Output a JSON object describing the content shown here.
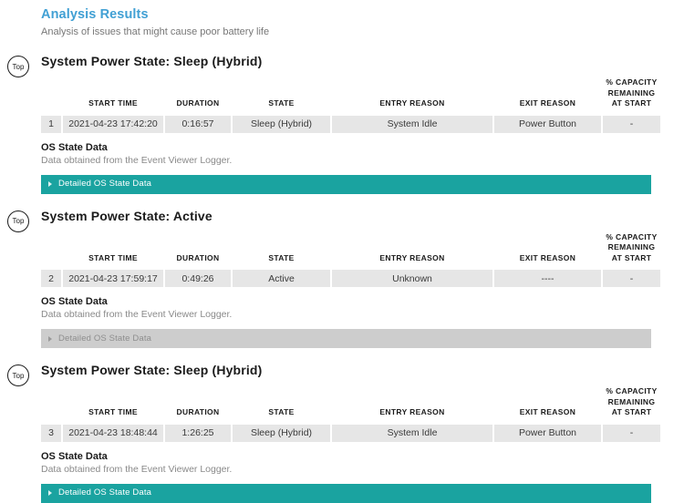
{
  "report": {
    "title": "Analysis Results",
    "subtitle": "Analysis of issues that might cause poor battery life",
    "title_color": "#41a0d4",
    "accent_teal": "#1aa3a0",
    "accent_gray": "#cdcdcd"
  },
  "top_badge_label": "Top",
  "columns": [
    "",
    "START TIME",
    "DURATION",
    "STATE",
    "ENTRY REASON",
    "EXIT REASON",
    "% CAPACITY REMAINING AT START"
  ],
  "columns_capacity_lines": [
    "% CAPACITY",
    "REMAINING",
    "AT START"
  ],
  "os_state": {
    "title": "OS State Data",
    "subtitle": "Data obtained from the Event Viewer Logger.",
    "detail_label": "Detailed OS State Data"
  },
  "sections": [
    {
      "heading": "System Power State: Sleep (Hybrid)",
      "row": {
        "index": "1",
        "start_time": "2021-04-23  17:42:20",
        "duration": "0:16:57",
        "state": "Sleep (Hybrid)",
        "entry_reason": "System Idle",
        "exit_reason": "Power Button",
        "capacity_remaining": "-"
      },
      "detail_bar_style": "teal"
    },
    {
      "heading": "System Power State: Active",
      "row": {
        "index": "2",
        "start_time": "2021-04-23  17:59:17",
        "duration": "0:49:26",
        "state": "Active",
        "entry_reason": "Unknown",
        "exit_reason": "----",
        "capacity_remaining": "-"
      },
      "detail_bar_style": "gray"
    },
    {
      "heading": "System Power State: Sleep (Hybrid)",
      "row": {
        "index": "3",
        "start_time": "2021-04-23  18:48:44",
        "duration": "1:26:25",
        "state": "Sleep (Hybrid)",
        "entry_reason": "System Idle",
        "exit_reason": "Power Button",
        "capacity_remaining": "-"
      },
      "detail_bar_style": "teal"
    }
  ]
}
